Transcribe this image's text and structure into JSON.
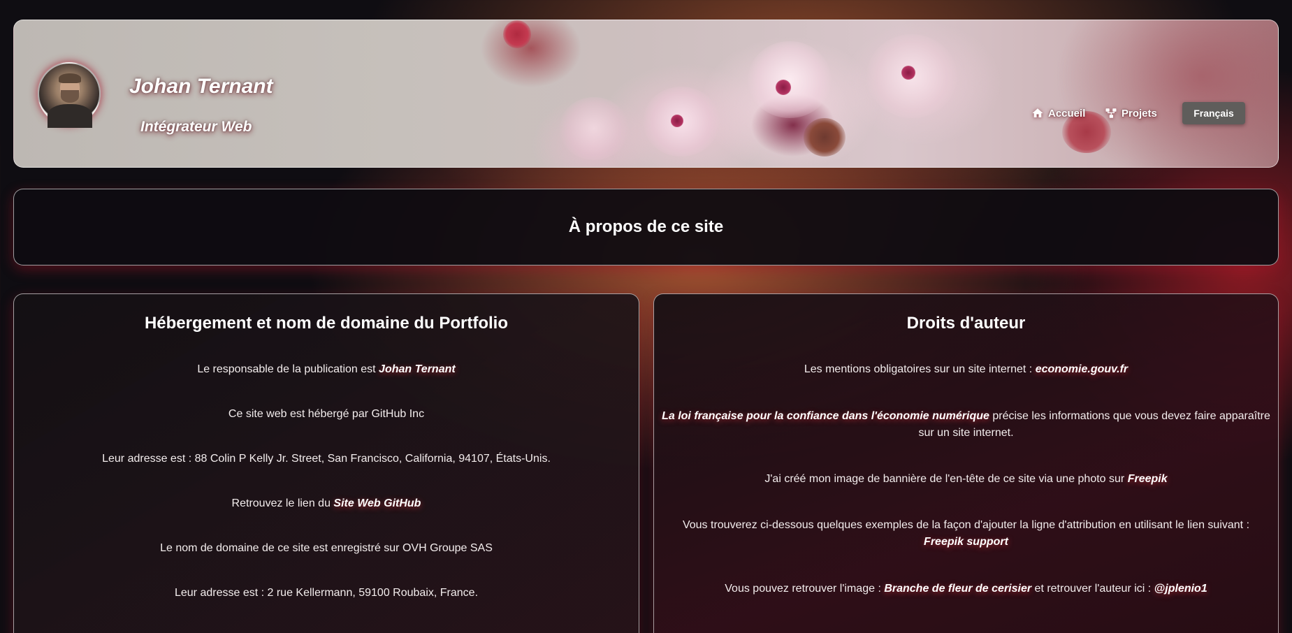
{
  "header": {
    "name": "Johan Ternant",
    "role": "Intégrateur Web",
    "nav": {
      "home_label": "Accueil",
      "projects_label": "Projets",
      "language_label": "Français"
    }
  },
  "page_title": "À propos de ce site",
  "hosting": {
    "title": "Hébergement et nom de domaine du Portfolio",
    "publisher_text": "Le responsable de la publication est ",
    "publisher_name": "Johan Ternant",
    "host_text": "Ce site web est hébergé par GitHub Inc",
    "host_address": "Leur adresse est : 88 Colin P Kelly Jr. Street, San Francisco, California, 94107, États-Unis.",
    "github_text": "Retrouvez le lien du ",
    "github_link": "Site Web GitHub",
    "domain_text": "Le nom de domaine de ce site est enregistré sur OVH Groupe SAS",
    "domain_address": "Leur adresse est : 2 rue Kellermann, 59100 Roubaix, France."
  },
  "copyright": {
    "title": "Droits d'auteur",
    "mentions_text": "Les mentions obligatoires sur un site internet : ",
    "mentions_link": "economie.gouv.fr",
    "law_link": "La loi française pour la confiance dans l'économie numérique",
    "law_text": " précise les informations que vous devez faire apparaître sur un site internet.",
    "banner_text": "J'ai créé mon image de bannière de l'en-tête de ce site via une photo sur ",
    "banner_link": "Freepik",
    "attribution_text": "Vous trouverez ci-dessous quelques exemples de la façon d'ajouter la ligne d'attribution en utilisant le lien suivant : ",
    "attribution_link": "Freepik support",
    "image_text": "Vous pouvez retrouver l'image : ",
    "image_link": "Branche de fleur de cerisier",
    "author_text": " et retrouver l'auteur ici : ",
    "author_link": "@jplenio1"
  },
  "colors": {
    "background": "#0f0d12",
    "accent_glow": "#a01428",
    "language_button": "#5f5d5b"
  },
  "icons": [
    "home-icon",
    "projects-icon"
  ]
}
